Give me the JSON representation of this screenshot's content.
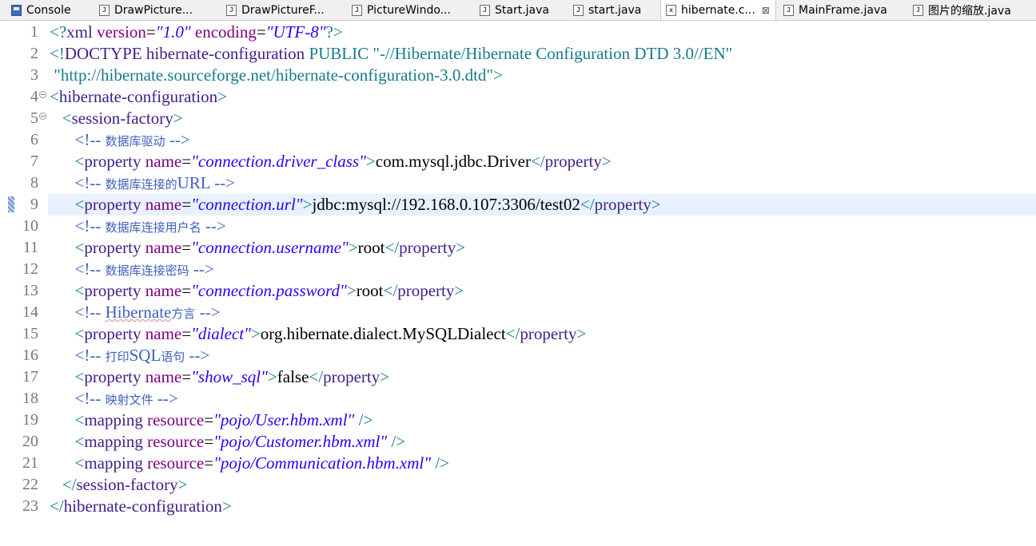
{
  "tabs": [
    {
      "label": "Console",
      "icon": "console-icon",
      "active": false
    },
    {
      "label": "DrawPicture...",
      "icon": "java-file-icon",
      "active": false
    },
    {
      "label": "DrawPictureF...",
      "icon": "java-file-icon",
      "active": false
    },
    {
      "label": "PictureWindo...",
      "icon": "java-file-icon",
      "active": false
    },
    {
      "label": "Start.java",
      "icon": "java-file-icon",
      "active": false
    },
    {
      "label": "start.java",
      "icon": "java-file-icon",
      "active": false
    },
    {
      "label": "hibernate.c...",
      "icon": "xml-file-icon",
      "active": true,
      "close": "⊠"
    },
    {
      "label": "MainFrame.java",
      "icon": "java-file-icon",
      "active": false
    },
    {
      "label": "图片的缩放.java",
      "icon": "java-file-icon",
      "active": false
    }
  ],
  "editor": {
    "current_line": 9,
    "colors": {
      "tag": "#177b8a",
      "element": "#3f1f8a",
      "attribute": "#7f007f",
      "value": "#2a00ff",
      "comment": "#3f5fbf",
      "highlight": "#e8f2fe"
    },
    "lines": [
      {
        "n": "1",
        "tokens": [
          [
            "tag",
            "<?"
          ],
          [
            "ename",
            "xml "
          ],
          [
            "aname",
            "version"
          ],
          [
            "plain",
            "="
          ],
          [
            "aval",
            "\"1.0\""
          ],
          [
            "plain",
            " "
          ],
          [
            "aname",
            "encoding"
          ],
          [
            "plain",
            "="
          ],
          [
            "aval",
            "\"UTF-8\""
          ],
          [
            "tag",
            "?>"
          ]
        ]
      },
      {
        "n": "2",
        "tokens": [
          [
            "tag",
            "<!"
          ],
          [
            "ename",
            "DOCTYPE hibernate-configuration "
          ],
          [
            "doctype",
            "PUBLIC \"-//Hibernate/Hibernate Configuration DTD 3.0//EN\""
          ]
        ]
      },
      {
        "n": "3",
        "tokens": [
          [
            "doctype",
            " \"http://hibernate.sourceforge.net/hibernate-configuration-3.0.dtd\">"
          ]
        ]
      },
      {
        "n": "4",
        "fold": true,
        "tokens": [
          [
            "tag",
            "<"
          ],
          [
            "ename",
            "hibernate-configuration"
          ],
          [
            "tag",
            ">"
          ]
        ]
      },
      {
        "n": "5",
        "fold": true,
        "tokens": [
          [
            "plain",
            "   "
          ],
          [
            "tag",
            "<"
          ],
          [
            "ename",
            "session-factory"
          ],
          [
            "tag",
            ">"
          ]
        ]
      },
      {
        "n": "6",
        "tokens": [
          [
            "plain",
            "      "
          ],
          [
            "comment",
            "<!-- "
          ],
          [
            "cjkc",
            "数据库驱动"
          ],
          [
            "comment",
            " -->"
          ]
        ]
      },
      {
        "n": "7",
        "tokens": [
          [
            "plain",
            "      "
          ],
          [
            "tag",
            "<"
          ],
          [
            "ename",
            "property "
          ],
          [
            "aname",
            "name"
          ],
          [
            "plain",
            "="
          ],
          [
            "aval",
            "\"connection.driver_class\""
          ],
          [
            "tag",
            ">"
          ],
          [
            "plain",
            "com.mysql.jdbc.Driver"
          ],
          [
            "tag",
            "</"
          ],
          [
            "ename",
            "property"
          ],
          [
            "tag",
            ">"
          ]
        ]
      },
      {
        "n": "8",
        "tokens": [
          [
            "plain",
            "      "
          ],
          [
            "comment",
            "<!-- "
          ],
          [
            "cjkc",
            "数据库连接的"
          ],
          [
            "comment",
            "URL -->"
          ]
        ]
      },
      {
        "n": "9",
        "marker": true,
        "tokens": [
          [
            "plain",
            "      "
          ],
          [
            "tag",
            "<"
          ],
          [
            "ename",
            "property "
          ],
          [
            "aname",
            "name"
          ],
          [
            "plain",
            "="
          ],
          [
            "aval",
            "\"connection.url\""
          ],
          [
            "tag",
            ">"
          ],
          [
            "plain",
            "jdbc:mysql://192.168.0.107:3306/test02"
          ],
          [
            "tag",
            "</"
          ],
          [
            "ename",
            "property"
          ],
          [
            "tag",
            ">"
          ]
        ]
      },
      {
        "n": "10",
        "tokens": [
          [
            "plain",
            "      "
          ],
          [
            "comment",
            "<!-- "
          ],
          [
            "cjkc",
            "数据库连接用户名"
          ],
          [
            "comment",
            " -->"
          ]
        ]
      },
      {
        "n": "11",
        "tokens": [
          [
            "plain",
            "      "
          ],
          [
            "tag",
            "<"
          ],
          [
            "ename",
            "property "
          ],
          [
            "aname",
            "name"
          ],
          [
            "plain",
            "="
          ],
          [
            "aval",
            "\"connection.username\""
          ],
          [
            "tag",
            ">"
          ],
          [
            "plain",
            "root"
          ],
          [
            "tag",
            "</"
          ],
          [
            "ename",
            "property"
          ],
          [
            "tag",
            ">"
          ]
        ]
      },
      {
        "n": "12",
        "tokens": [
          [
            "plain",
            "      "
          ],
          [
            "comment",
            "<!-- "
          ],
          [
            "cjkc",
            "数据库连接密码"
          ],
          [
            "comment",
            " -->"
          ]
        ]
      },
      {
        "n": "13",
        "tokens": [
          [
            "plain",
            "      "
          ],
          [
            "tag",
            "<"
          ],
          [
            "ename",
            "property "
          ],
          [
            "aname",
            "name"
          ],
          [
            "plain",
            "="
          ],
          [
            "aval",
            "\"connection.password\""
          ],
          [
            "tag",
            ">"
          ],
          [
            "plain",
            "root"
          ],
          [
            "tag",
            "</"
          ],
          [
            "ename",
            "property"
          ],
          [
            "tag",
            ">"
          ]
        ]
      },
      {
        "n": "14",
        "tokens": [
          [
            "plain",
            "      "
          ],
          [
            "comment",
            "<!-- "
          ],
          [
            "commentsq",
            "Hibernate"
          ],
          [
            "cjkc",
            "方言"
          ],
          [
            "comment",
            " -->"
          ]
        ]
      },
      {
        "n": "15",
        "tokens": [
          [
            "plain",
            "      "
          ],
          [
            "tag",
            "<"
          ],
          [
            "ename",
            "property "
          ],
          [
            "aname",
            "name"
          ],
          [
            "plain",
            "="
          ],
          [
            "aval",
            "\"dialect\""
          ],
          [
            "tag",
            ">"
          ],
          [
            "plain",
            "org.hibernate.dialect.MySQLDialect"
          ],
          [
            "tag",
            "</"
          ],
          [
            "ename",
            "property"
          ],
          [
            "tag",
            ">"
          ]
        ]
      },
      {
        "n": "16",
        "tokens": [
          [
            "plain",
            "      "
          ],
          [
            "comment",
            "<!-- "
          ],
          [
            "cjkc",
            "打印"
          ],
          [
            "comment",
            "SQL"
          ],
          [
            "cjkc",
            "语句"
          ],
          [
            "comment",
            " -->"
          ]
        ]
      },
      {
        "n": "17",
        "tokens": [
          [
            "plain",
            "      "
          ],
          [
            "tag",
            "<"
          ],
          [
            "ename",
            "property "
          ],
          [
            "aname",
            "name"
          ],
          [
            "plain",
            "="
          ],
          [
            "aval",
            "\"show_sql\""
          ],
          [
            "tag",
            ">"
          ],
          [
            "plain",
            "false"
          ],
          [
            "tag",
            "</"
          ],
          [
            "ename",
            "property"
          ],
          [
            "tag",
            ">"
          ]
        ]
      },
      {
        "n": "18",
        "tokens": [
          [
            "plain",
            "      "
          ],
          [
            "comment",
            "<!-- "
          ],
          [
            "cjkc",
            "映射文件"
          ],
          [
            "comment",
            " -->"
          ]
        ]
      },
      {
        "n": "19",
        "tokens": [
          [
            "plain",
            "      "
          ],
          [
            "tag",
            "<"
          ],
          [
            "ename",
            "mapping "
          ],
          [
            "aname",
            "resource"
          ],
          [
            "plain",
            "="
          ],
          [
            "aval",
            "\"pojo/User.hbm.xml\""
          ],
          [
            "tag",
            " />"
          ]
        ]
      },
      {
        "n": "20",
        "tokens": [
          [
            "plain",
            "      "
          ],
          [
            "tag",
            "<"
          ],
          [
            "ename",
            "mapping "
          ],
          [
            "aname",
            "resource"
          ],
          [
            "plain",
            "="
          ],
          [
            "aval",
            "\"pojo/Customer.hbm.xml\""
          ],
          [
            "tag",
            " />"
          ]
        ]
      },
      {
        "n": "21",
        "tokens": [
          [
            "plain",
            "      "
          ],
          [
            "tag",
            "<"
          ],
          [
            "ename",
            "mapping "
          ],
          [
            "aname",
            "resource"
          ],
          [
            "plain",
            "="
          ],
          [
            "aval",
            "\"pojo/Communication.hbm.xml\""
          ],
          [
            "tag",
            " />"
          ]
        ]
      },
      {
        "n": "22",
        "tokens": [
          [
            "plain",
            "   "
          ],
          [
            "tag",
            "</"
          ],
          [
            "ename",
            "session-factory"
          ],
          [
            "tag",
            ">"
          ]
        ]
      },
      {
        "n": "23",
        "tokens": [
          [
            "tag",
            "</"
          ],
          [
            "ename",
            "hibernate-configuration"
          ],
          [
            "tag",
            ">"
          ]
        ]
      }
    ]
  }
}
